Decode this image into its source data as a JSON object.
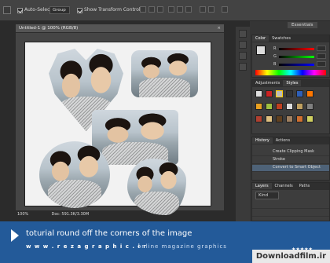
{
  "options_bar": {
    "auto_select_label": "Auto-Select:",
    "auto_select_checked": true,
    "group_value": "Group",
    "show_transform_label": "Show Transform Controls",
    "show_transform_checked": true,
    "workspace_label": "Essentials"
  },
  "document": {
    "tab_title": "Untitled-1 @ 100% (RGB/8)",
    "zoom": "100%",
    "doc_size": "Doc: 591.3K/3.30M"
  },
  "panels": {
    "color_tabs": [
      "Color",
      "Swatches"
    ],
    "color_channels": [
      "R",
      "G",
      "B"
    ],
    "color_values": [
      "",
      "",
      ""
    ],
    "adjust_tabs": [
      "Adjustments",
      "Styles"
    ],
    "history_tabs": [
      "History",
      "Actions"
    ],
    "history_items": [
      "Create Clipping Mask",
      "Stroke",
      "Convert to Smart Object"
    ],
    "layers_tabs": [
      "Layers",
      "Channels",
      "Paths"
    ],
    "layers_kind": "Kind"
  },
  "banner": {
    "title": "toturial round off the corners of the image",
    "url": "w w w . r e z a g r a p h i c . i r",
    "subtitle": "online magazine graphics",
    "watermark": "Downloadfilm.ir",
    "stars": "★★★★★"
  },
  "colors": {
    "banner_bg": "#235a99",
    "ui_bg": "#353535",
    "canvas_bg": "#f2f2f2",
    "history_selected": "#4e6277"
  }
}
